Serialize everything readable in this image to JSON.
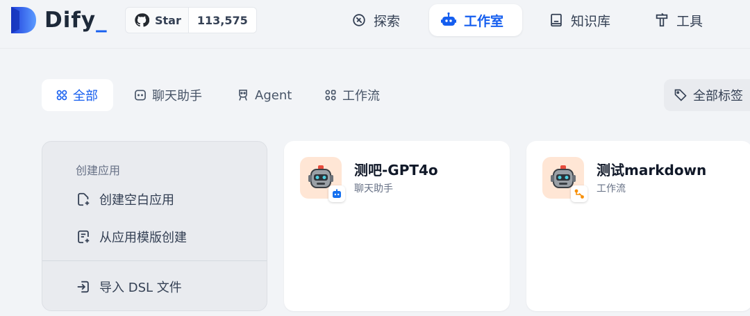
{
  "header": {
    "logo_text": "Dify",
    "logo_suffix": "_",
    "github": {
      "star_label": "Star",
      "star_count": "113,575"
    },
    "nav": [
      {
        "label": "探索",
        "icon": "compass-icon"
      },
      {
        "label": "工作室",
        "icon": "robot-icon",
        "active": true
      },
      {
        "label": "知识库",
        "icon": "book-icon"
      },
      {
        "label": "工具",
        "icon": "hammer-icon"
      }
    ]
  },
  "filters": {
    "tabs": [
      {
        "label": "全部",
        "icon": "grid-icon",
        "active": true
      },
      {
        "label": "聊天助手",
        "icon": "chat-bubble-icon"
      },
      {
        "label": "Agent",
        "icon": "agent-icon"
      },
      {
        "label": "工作流",
        "icon": "workflow-icon"
      }
    ],
    "tag_filter": {
      "label": "全部标签",
      "icon": "tag-icon"
    }
  },
  "create_card": {
    "title": "创建应用",
    "items": [
      {
        "label": "创建空白应用",
        "icon": "file-plus-icon"
      },
      {
        "label": "从应用模版创建",
        "icon": "file-template-icon"
      },
      {
        "label": "导入 DSL 文件",
        "icon": "import-icon"
      }
    ]
  },
  "apps": [
    {
      "name": "测吧-GPT4o",
      "type": "聊天助手",
      "icon": "robot-avatar-icon",
      "badge_icon": "chat-badge-icon",
      "badge_color": "#1570ef"
    },
    {
      "name": "测试markdown",
      "type": "工作流",
      "icon": "robot-avatar-icon",
      "badge_icon": "workflow-badge-icon",
      "badge_color": "#f79009"
    }
  ],
  "colors": {
    "accent": "#155eef",
    "background": "#f2f4f7",
    "avatar_bg": "#ffe6d5"
  }
}
